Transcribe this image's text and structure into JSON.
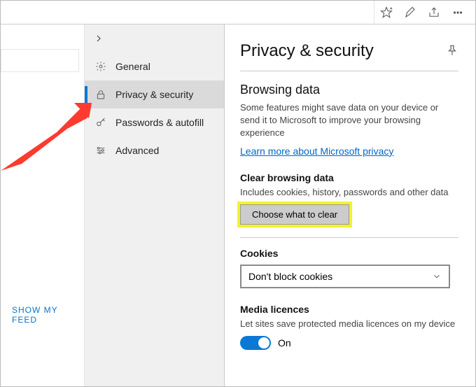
{
  "toolbar": {
    "address_value": "",
    "favorites_icon": "favorites",
    "notes_icon": "notes",
    "share_icon": "share",
    "more_icon": "more"
  },
  "left": {
    "show_feed": "SHOW MY FEED"
  },
  "sidebar": {
    "items": [
      {
        "label": "General",
        "selected": false
      },
      {
        "label": "Privacy & security",
        "selected": true
      },
      {
        "label": "Passwords & autofill",
        "selected": false
      },
      {
        "label": "Advanced",
        "selected": false
      }
    ]
  },
  "panel": {
    "title": "Privacy & security",
    "browsing_heading": "Browsing data",
    "browsing_body": "Some features might save data on your device or send it to Microsoft to improve your browsing experience",
    "browsing_link": "Learn more about Microsoft privacy",
    "clear_label": "Clear browsing data",
    "clear_body": "Includes cookies, history, passwords and other data",
    "clear_button": "Choose what to clear",
    "cookies_label": "Cookies",
    "cookies_select": "Don't block cookies",
    "media_label": "Media licences",
    "media_body": "Let sites save protected media licences on my device",
    "media_toggle": "On"
  }
}
